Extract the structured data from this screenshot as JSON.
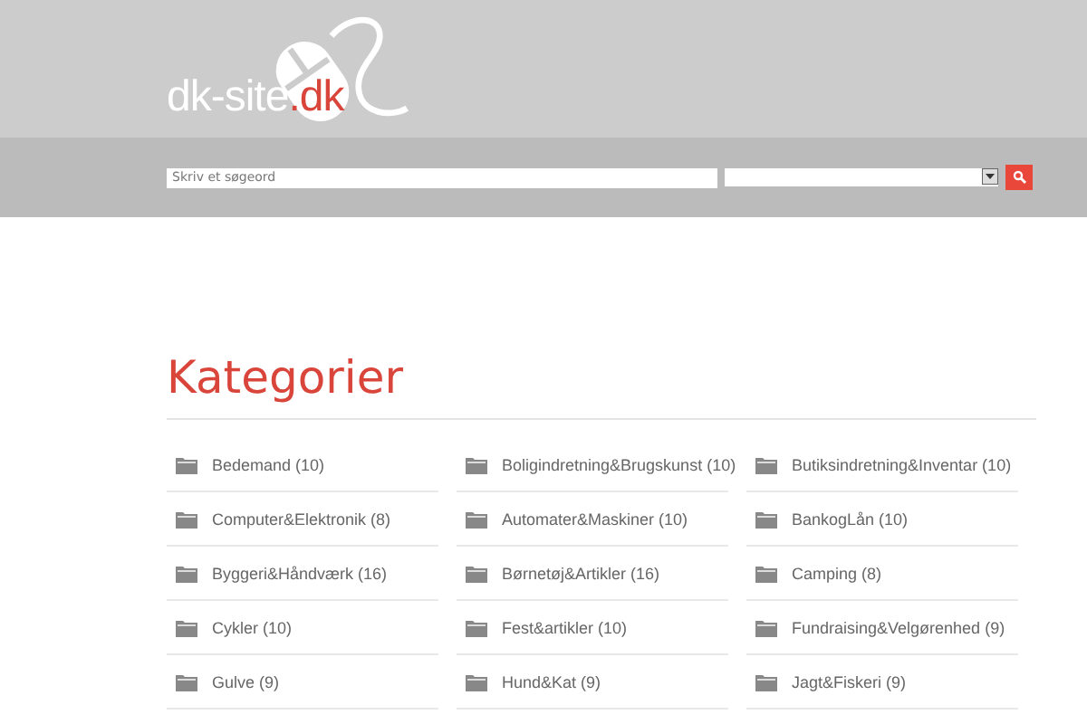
{
  "logo": {
    "name": "dk-site",
    "tld": ".dk"
  },
  "search": {
    "placeholder": "Skriv et søgeord"
  },
  "heading": "Kategorier",
  "categories": [
    {
      "label": "Bedemand (10)"
    },
    {
      "label": "Boligindretning&Brugskunst (10)"
    },
    {
      "label": "Butiksindretning&Inventar (10)"
    },
    {
      "label": "Computer&Elektronik (8)"
    },
    {
      "label": "Automater&Maskiner (10)"
    },
    {
      "label": "BankogLån (10)"
    },
    {
      "label": "Byggeri&Håndværk (16)"
    },
    {
      "label": "Børnetøj&Artikler (16)"
    },
    {
      "label": "Camping (8)"
    },
    {
      "label": "Cykler (10)"
    },
    {
      "label": "Fest&artikler (10)"
    },
    {
      "label": "Fundraising&Velgørenhed (9)"
    },
    {
      "label": "Gulve (9)"
    },
    {
      "label": "Hund&Kat (9)"
    },
    {
      "label": "Jagt&Fiskeri (9)"
    }
  ]
}
